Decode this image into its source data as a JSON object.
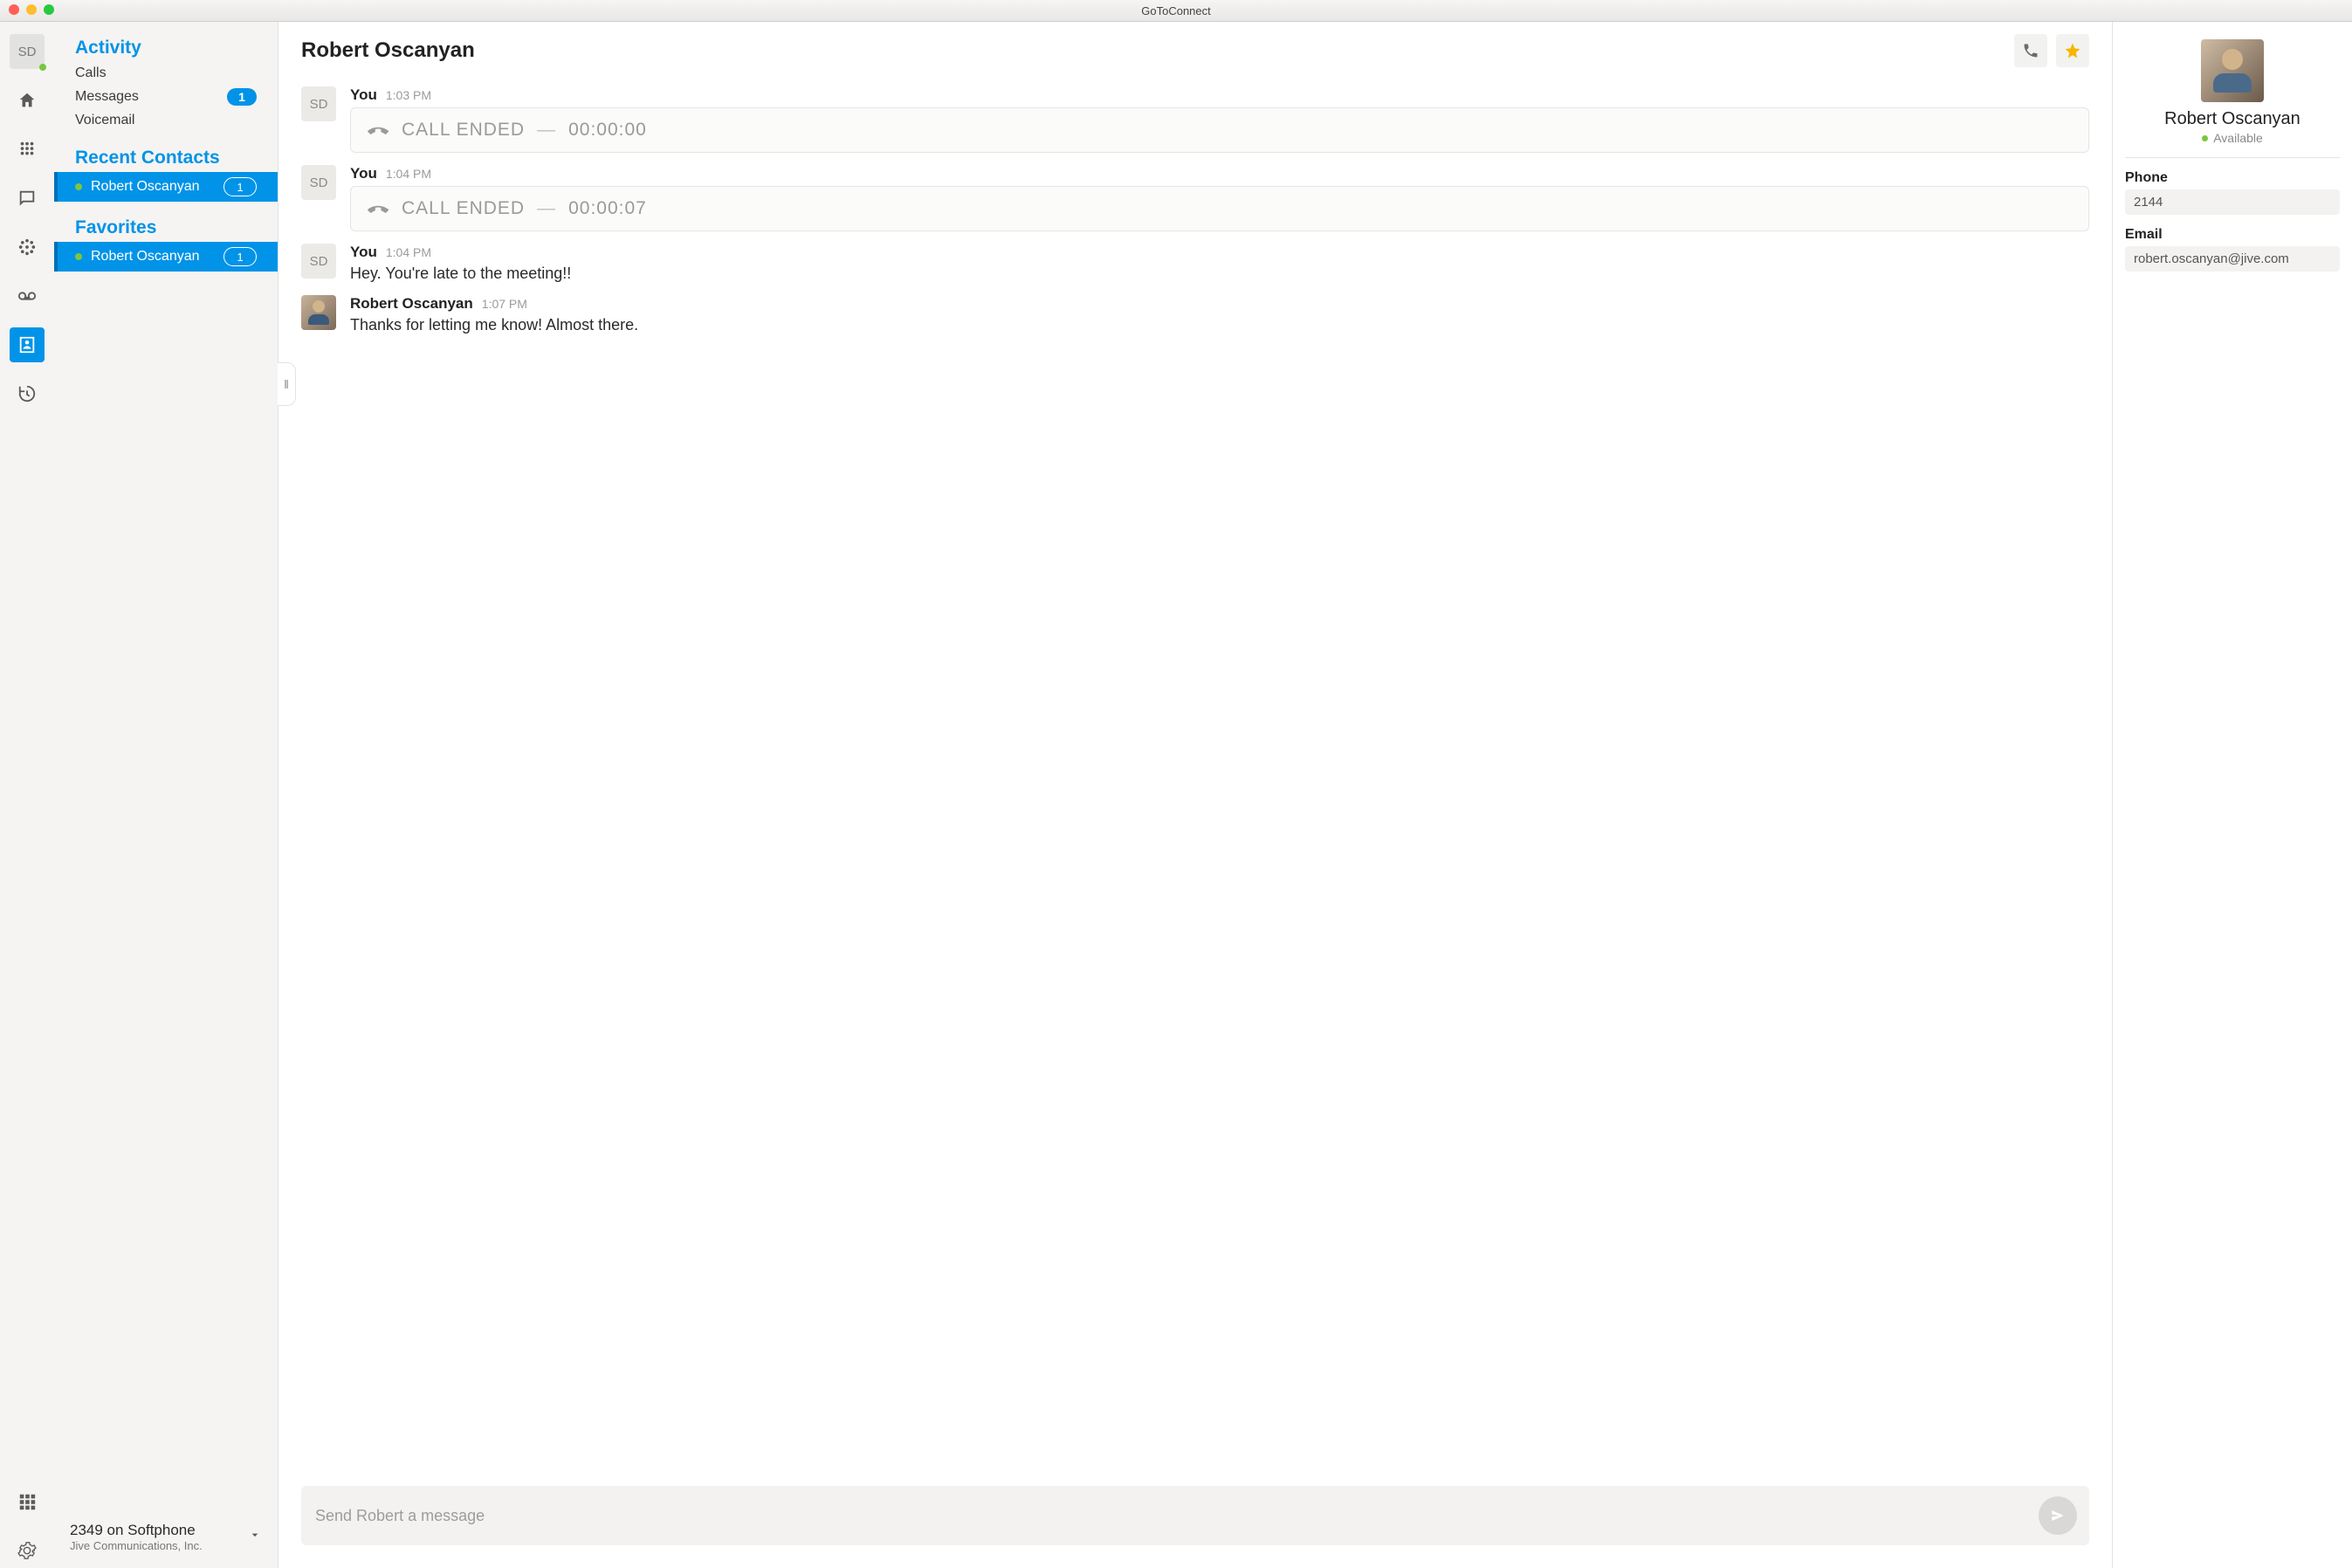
{
  "app_title": "GoToConnect",
  "user": {
    "initials": "SD"
  },
  "sidebar": {
    "activity": {
      "title": "Activity",
      "calls": "Calls",
      "messages": "Messages",
      "messages_badge": "1",
      "voicemail": "Voicemail"
    },
    "recent": {
      "title": "Recent Contacts",
      "items": [
        {
          "name": "Robert Oscanyan",
          "count": "1"
        }
      ]
    },
    "favorites": {
      "title": "Favorites",
      "items": [
        {
          "name": "Robert Oscanyan",
          "count": "1"
        }
      ]
    }
  },
  "footer_line": {
    "line1": "2349 on Softphone",
    "line2": "Jive Communications, Inc."
  },
  "conversation": {
    "title": "Robert Oscanyan",
    "messages": [
      {
        "who": "You",
        "time": "1:03 PM",
        "type": "call",
        "label": "CALL ENDED",
        "sep": "—",
        "duration": "00:00:00",
        "initials": "SD"
      },
      {
        "who": "You",
        "time": "1:04 PM",
        "type": "call",
        "label": "CALL ENDED",
        "sep": "—",
        "duration": "00:00:07",
        "initials": "SD"
      },
      {
        "who": "You",
        "time": "1:04 PM",
        "type": "text",
        "text": "Hey. You're late to the meeting!!",
        "initials": "SD"
      },
      {
        "who": "Robert Oscanyan",
        "time": "1:07 PM",
        "type": "text",
        "text": "Thanks for letting me know! Almost there.",
        "photo": true
      }
    ],
    "composer_placeholder": "Send Robert a message"
  },
  "rpanel": {
    "name": "Robert Oscanyan",
    "status": "Available",
    "phone_label": "Phone",
    "phone": "2144",
    "email_label": "Email",
    "email": "robert.oscanyan@jive.com"
  }
}
